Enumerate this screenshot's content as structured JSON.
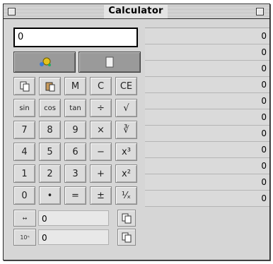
{
  "window": {
    "title": "Calculator"
  },
  "display": {
    "value": "0"
  },
  "mode": {
    "left_icon": "paint-splash-icon",
    "right_icon": "document-icon"
  },
  "keys": [
    {
      "label": "",
      "icon": "copy-icon",
      "name": "copy-button"
    },
    {
      "label": "",
      "icon": "paste-icon",
      "name": "paste-button"
    },
    {
      "label": "M",
      "name": "memory-button"
    },
    {
      "label": "C",
      "name": "clear-button"
    },
    {
      "label": "CE",
      "name": "clear-entry-button"
    },
    {
      "label": "sin",
      "name": "sin-button",
      "small": true
    },
    {
      "label": "cos",
      "name": "cos-button",
      "small": true
    },
    {
      "label": "tan",
      "name": "tan-button",
      "small": true
    },
    {
      "label": "÷",
      "name": "divide-button"
    },
    {
      "label": "√",
      "name": "sqrt-button"
    },
    {
      "label": "7",
      "name": "digit-7-button"
    },
    {
      "label": "8",
      "name": "digit-8-button"
    },
    {
      "label": "9",
      "name": "digit-9-button"
    },
    {
      "label": "×",
      "name": "multiply-button"
    },
    {
      "label": "∛",
      "name": "cube-root-button"
    },
    {
      "label": "4",
      "name": "digit-4-button"
    },
    {
      "label": "5",
      "name": "digit-5-button"
    },
    {
      "label": "6",
      "name": "digit-6-button"
    },
    {
      "label": "−",
      "name": "subtract-button"
    },
    {
      "label": "x³",
      "name": "cube-button"
    },
    {
      "label": "1",
      "name": "digit-1-button"
    },
    {
      "label": "2",
      "name": "digit-2-button"
    },
    {
      "label": "3",
      "name": "digit-3-button"
    },
    {
      "label": "+",
      "name": "add-button"
    },
    {
      "label": "x²",
      "name": "square-button"
    },
    {
      "label": "0",
      "name": "digit-0-button"
    },
    {
      "label": "•",
      "name": "decimal-button"
    },
    {
      "label": "=",
      "name": "equals-button"
    },
    {
      "label": "±",
      "name": "sign-button"
    },
    {
      "label": "¹⁄ₓ",
      "name": "reciprocal-button"
    }
  ],
  "memory_rows": [
    {
      "icon": "arrows-icon",
      "icon_text": "↔",
      "value": "0",
      "copy_icon": "copy-icon"
    },
    {
      "icon": "sci-icon",
      "icon_text": "10ⁿ",
      "value": "0",
      "copy_icon": "copy-icon"
    }
  ],
  "tape": [
    "0",
    "0",
    "0",
    "0",
    "0",
    "0",
    "0",
    "0",
    "0",
    "0",
    "0"
  ]
}
